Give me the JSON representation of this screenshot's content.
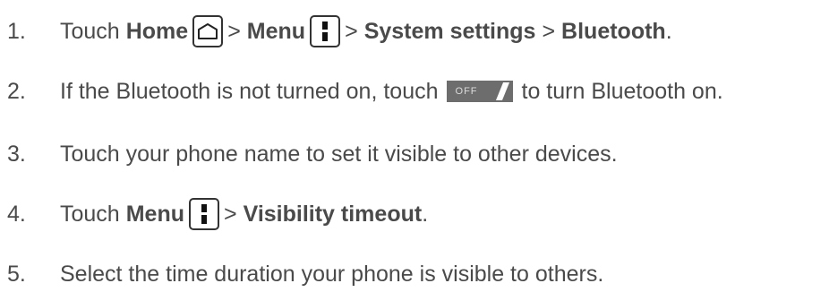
{
  "steps": [
    {
      "num": "1.",
      "t1": "Touch ",
      "b1": "Home",
      "t2": " > ",
      "b2": "Menu",
      "t3": " > ",
      "b3": "System settings",
      "t4": " > ",
      "b4": "Bluetooth",
      "t5": "."
    },
    {
      "num": "2.",
      "t1": "If the Bluetooth is not turned on, touch",
      "toggle": "OFF",
      "t2": "to turn Bluetooth on."
    },
    {
      "num": "3.",
      "t1": "Touch your phone name to set it visible to other devices."
    },
    {
      "num": "4.",
      "t1": "Touch ",
      "b1": "Menu",
      "t2": " > ",
      "b2": "Visibility timeout",
      "t3": "."
    },
    {
      "num": "5.",
      "t1": "Select the time duration your phone is visible to others."
    }
  ],
  "icons": {
    "home": "home-key-icon",
    "menu": "menu-key-icon",
    "toggle": "bluetooth-off-toggle-icon"
  },
  "colors": {
    "text": "#4a4a4a",
    "toggle_bg": "#6d6d6d"
  }
}
